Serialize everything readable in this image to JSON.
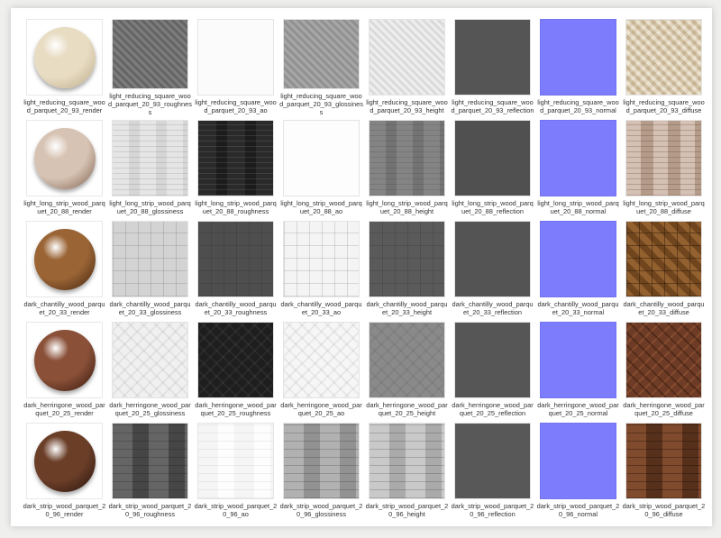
{
  "colors": {
    "render_square": "#ddd0b4",
    "render_long": "#b99c8a",
    "render_chantilly": "#7a4a22",
    "render_herringone": "#6a3b26",
    "render_strip": "#4b2a1c",
    "normal": "#7c7cfc"
  },
  "rows": [
    {
      "name": "light-reducing-square",
      "items": [
        {
          "kind": "sphere",
          "tone": "#e8dcc3",
          "shade": "#b9a784",
          "label": "light_reducing_square_wood_parquet_20_93_render"
        },
        {
          "kind": "tex",
          "bg": "#6d6d6d",
          "pattern": "diag",
          "label": "light_reducing_square_wood_parquet_20_93_roughness"
        },
        {
          "kind": "tex",
          "bg": "#fbfbfb",
          "pattern": "none",
          "label": "light_reducing_square_wood_parquet_20_93_ao"
        },
        {
          "kind": "tex",
          "bg": "#9c9c9c",
          "pattern": "diag",
          "label": "light_reducing_square_wood_parquet_20_93_glossiness"
        },
        {
          "kind": "tex",
          "bg": "#ececec",
          "pattern": "diag",
          "label": "light_reducing_square_wood_parquet_20_93_height"
        },
        {
          "kind": "tex",
          "bg": "#555555",
          "pattern": "none",
          "label": "light_reducing_square_wood_parquet_20_93_reflection"
        },
        {
          "kind": "normal",
          "bg": "#7c7cfc",
          "pattern": "none",
          "label": "light_reducing_square_wood_parquet_20_93_normal"
        },
        {
          "kind": "tex",
          "bg": "#e2d3b5",
          "pattern": "diagwarm",
          "label": "light_reducing_square_wood_parquet_20_93_diffuse"
        }
      ]
    },
    {
      "name": "light-long-strip",
      "items": [
        {
          "kind": "sphere",
          "tone": "#d7c3b3",
          "shade": "#7c5b4a",
          "label": "light_long_strip_wood_parquet_20_88_render"
        },
        {
          "kind": "tex",
          "bg": "#e3e3e3",
          "pattern": "strip",
          "label": "light_long_strip_wood_parquet_20_88_glossiness"
        },
        {
          "kind": "tex",
          "bg": "#1f1f1f",
          "pattern": "stripdark",
          "label": "light_long_strip_wood_parquet_20_88_roughness"
        },
        {
          "kind": "tex",
          "bg": "#fdfdfd",
          "pattern": "none",
          "label": "light_long_strip_wood_parquet_20_88_ao"
        },
        {
          "kind": "tex",
          "bg": "#7a7a7a",
          "pattern": "strip",
          "label": "light_long_strip_wood_parquet_20_88_height"
        },
        {
          "kind": "tex",
          "bg": "#505050",
          "pattern": "none",
          "label": "light_long_strip_wood_parquet_20_88_reflection"
        },
        {
          "kind": "normal",
          "bg": "#7c7cfc",
          "pattern": "none",
          "label": "light_long_strip_wood_parquet_20_88_normal"
        },
        {
          "kind": "tex",
          "bg": "#cbb3a3",
          "pattern": "stripwarm",
          "label": "light_long_strip_wood_parquet_20_88_diffuse"
        }
      ]
    },
    {
      "name": "dark-chantilly",
      "items": [
        {
          "kind": "sphere",
          "tone": "#9a6435",
          "shade": "#3e210d",
          "label": "dark_chantilly_wood_parquet_20_33_render"
        },
        {
          "kind": "tex",
          "bg": "#d3d3d3",
          "pattern": "grid",
          "label": "dark_chantilly_wood_parquet_20_33_glossiness"
        },
        {
          "kind": "tex",
          "bg": "#4e4e4e",
          "pattern": "grid",
          "label": "dark_chantilly_wood_parquet_20_33_roughness"
        },
        {
          "kind": "tex",
          "bg": "#f4f4f4",
          "pattern": "grid",
          "label": "dark_chantilly_wood_parquet_20_33_ao"
        },
        {
          "kind": "tex",
          "bg": "#5a5a5a",
          "pattern": "grid",
          "label": "dark_chantilly_wood_parquet_20_33_height"
        },
        {
          "kind": "tex",
          "bg": "#545454",
          "pattern": "none",
          "label": "dark_chantilly_wood_parquet_20_33_reflection"
        },
        {
          "kind": "normal",
          "bg": "#7c7cfc",
          "pattern": "none",
          "label": "dark_chantilly_wood_parquet_20_33_normal"
        },
        {
          "kind": "tex",
          "bg": "#7f4f22",
          "pattern": "gridwarm",
          "label": "dark_chantilly_wood_parquet_20_33_diffuse"
        }
      ]
    },
    {
      "name": "dark-herringone",
      "items": [
        {
          "kind": "sphere",
          "tone": "#8a5038",
          "shade": "#301408",
          "label": "dark_herringone_wood_parquet_20_25_render"
        },
        {
          "kind": "tex",
          "bg": "#f0f0f0",
          "pattern": "herring",
          "label": "dark_herringone_wood_parquet_20_25_glossiness"
        },
        {
          "kind": "tex",
          "bg": "#1e1e1e",
          "pattern": "herringdark",
          "label": "dark_herringone_wood_parquet_20_25_roughness"
        },
        {
          "kind": "tex",
          "bg": "#f6f6f6",
          "pattern": "herring",
          "label": "dark_herringone_wood_parquet_20_25_ao"
        },
        {
          "kind": "tex",
          "bg": "#8a8a8a",
          "pattern": "herring",
          "label": "dark_herringone_wood_parquet_20_25_height"
        },
        {
          "kind": "tex",
          "bg": "#565656",
          "pattern": "none",
          "label": "dark_herringone_wood_parquet_20_25_reflection"
        },
        {
          "kind": "normal",
          "bg": "#7c7cfc",
          "pattern": "none",
          "label": "dark_herringone_wood_parquet_20_25_normal"
        },
        {
          "kind": "tex",
          "bg": "#6e3c26",
          "pattern": "herringwarm",
          "label": "dark_herringone_wood_parquet_20_25_diffuse"
        }
      ]
    },
    {
      "name": "dark-strip",
      "items": [
        {
          "kind": "sphere",
          "tone": "#6b3e28",
          "shade": "#22100a",
          "label": "dark_strip_wood_parquet_20_96_render"
        },
        {
          "kind": "tex",
          "bg": "#505050",
          "pattern": "bricks",
          "label": "dark_strip_wood_parquet_20_96_roughness"
        },
        {
          "kind": "tex",
          "bg": "#fdfdfd",
          "pattern": "brickslight",
          "label": "dark_strip_wood_parquet_20_96_ao"
        },
        {
          "kind": "tex",
          "bg": "#a6a6a6",
          "pattern": "bricks",
          "label": "dark_strip_wood_parquet_20_96_glossiness"
        },
        {
          "kind": "tex",
          "bg": "#c2c2c2",
          "pattern": "bricks",
          "label": "dark_strip_wood_parquet_20_96_height"
        },
        {
          "kind": "tex",
          "bg": "#585858",
          "pattern": "none",
          "label": "dark_strip_wood_parquet_20_96_reflection"
        },
        {
          "kind": "normal",
          "bg": "#7c7cfc",
          "pattern": "none",
          "label": "dark_strip_wood_parquet_20_96_normal"
        },
        {
          "kind": "tex",
          "bg": "#6a3a22",
          "pattern": "brickswarm",
          "label": "dark_strip_wood_parquet_20_96_diffuse"
        }
      ]
    }
  ]
}
